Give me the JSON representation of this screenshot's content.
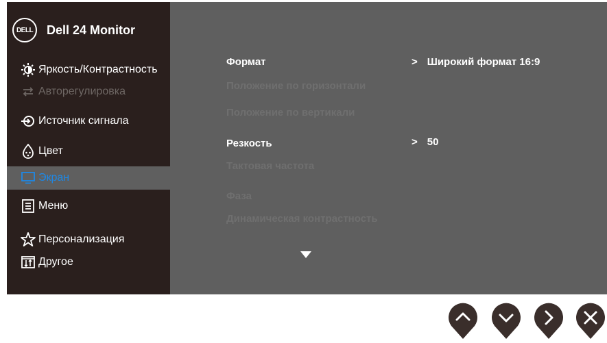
{
  "header": {
    "logo_text": "DELL",
    "title": "Dell 24 Monitor"
  },
  "sidebar": {
    "items": [
      {
        "label": "Яркость/Контрастность",
        "icon": "brightness-icon",
        "state": "normal"
      },
      {
        "label": "Авторегулировка",
        "icon": "auto-adjust-icon",
        "state": "disabled"
      },
      {
        "label": "Источник сигнала",
        "icon": "input-source-icon",
        "state": "normal"
      },
      {
        "label": "Цвет",
        "icon": "color-icon",
        "state": "normal"
      },
      {
        "label": "Экран",
        "icon": "display-icon",
        "state": "selected"
      },
      {
        "label": "Меню",
        "icon": "menu-icon",
        "state": "normal"
      },
      {
        "label": "Персонализация",
        "icon": "star-icon",
        "state": "normal"
      },
      {
        "label": "Другое",
        "icon": "others-icon",
        "state": "normal"
      }
    ]
  },
  "settings": {
    "rows": [
      {
        "label": "Формат",
        "enabled": true,
        "value": "Широкий формат 16:9"
      },
      {
        "label": "Положение по горизонтали",
        "enabled": false
      },
      {
        "label": "Положение по вертикали",
        "enabled": false
      },
      {
        "label": "Резкость",
        "enabled": true,
        "value": "50"
      },
      {
        "label": "Тактовая частота",
        "enabled": false
      },
      {
        "label": "Фаза",
        "enabled": false
      },
      {
        "label": "Динамическая контрастность",
        "enabled": false
      }
    ],
    "chevron": ">"
  },
  "buttons": [
    "up-button",
    "down-button",
    "right-button",
    "close-button"
  ],
  "colors": {
    "panel": "#5f5f5f",
    "sidebar": "#2a1f1d",
    "selected_text": "#1e88e5",
    "disabled_text": "#6f6f6f",
    "text": "#ffffff"
  }
}
